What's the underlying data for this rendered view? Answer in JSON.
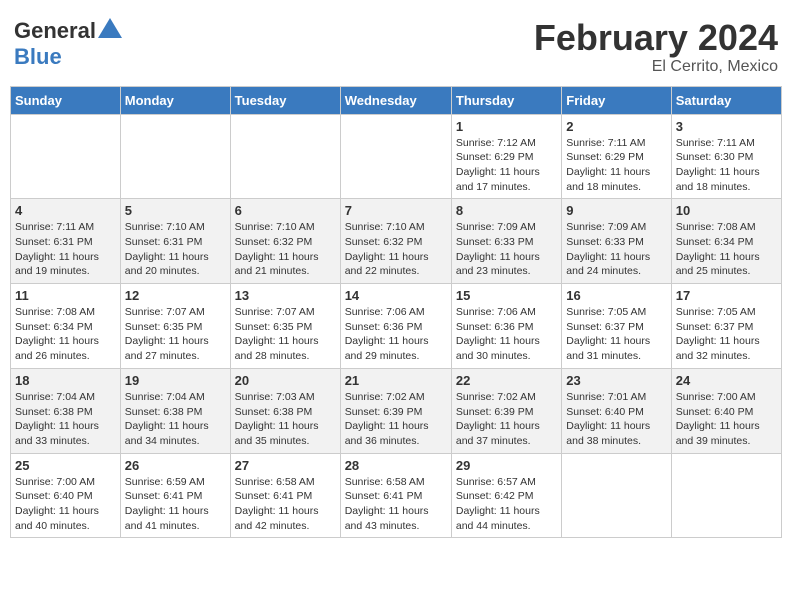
{
  "header": {
    "logo_general": "General",
    "logo_blue": "Blue",
    "month_year": "February 2024",
    "location": "El Cerrito, Mexico"
  },
  "weekdays": [
    "Sunday",
    "Monday",
    "Tuesday",
    "Wednesday",
    "Thursday",
    "Friday",
    "Saturday"
  ],
  "weeks": [
    [
      {
        "day": "",
        "sunrise": "",
        "sunset": "",
        "daylight": ""
      },
      {
        "day": "",
        "sunrise": "",
        "sunset": "",
        "daylight": ""
      },
      {
        "day": "",
        "sunrise": "",
        "sunset": "",
        "daylight": ""
      },
      {
        "day": "",
        "sunrise": "",
        "sunset": "",
        "daylight": ""
      },
      {
        "day": "1",
        "sunrise": "Sunrise: 7:12 AM",
        "sunset": "Sunset: 6:29 PM",
        "daylight": "Daylight: 11 hours and 17 minutes."
      },
      {
        "day": "2",
        "sunrise": "Sunrise: 7:11 AM",
        "sunset": "Sunset: 6:29 PM",
        "daylight": "Daylight: 11 hours and 18 minutes."
      },
      {
        "day": "3",
        "sunrise": "Sunrise: 7:11 AM",
        "sunset": "Sunset: 6:30 PM",
        "daylight": "Daylight: 11 hours and 18 minutes."
      }
    ],
    [
      {
        "day": "4",
        "sunrise": "Sunrise: 7:11 AM",
        "sunset": "Sunset: 6:31 PM",
        "daylight": "Daylight: 11 hours and 19 minutes."
      },
      {
        "day": "5",
        "sunrise": "Sunrise: 7:10 AM",
        "sunset": "Sunset: 6:31 PM",
        "daylight": "Daylight: 11 hours and 20 minutes."
      },
      {
        "day": "6",
        "sunrise": "Sunrise: 7:10 AM",
        "sunset": "Sunset: 6:32 PM",
        "daylight": "Daylight: 11 hours and 21 minutes."
      },
      {
        "day": "7",
        "sunrise": "Sunrise: 7:10 AM",
        "sunset": "Sunset: 6:32 PM",
        "daylight": "Daylight: 11 hours and 22 minutes."
      },
      {
        "day": "8",
        "sunrise": "Sunrise: 7:09 AM",
        "sunset": "Sunset: 6:33 PM",
        "daylight": "Daylight: 11 hours and 23 minutes."
      },
      {
        "day": "9",
        "sunrise": "Sunrise: 7:09 AM",
        "sunset": "Sunset: 6:33 PM",
        "daylight": "Daylight: 11 hours and 24 minutes."
      },
      {
        "day": "10",
        "sunrise": "Sunrise: 7:08 AM",
        "sunset": "Sunset: 6:34 PM",
        "daylight": "Daylight: 11 hours and 25 minutes."
      }
    ],
    [
      {
        "day": "11",
        "sunrise": "Sunrise: 7:08 AM",
        "sunset": "Sunset: 6:34 PM",
        "daylight": "Daylight: 11 hours and 26 minutes."
      },
      {
        "day": "12",
        "sunrise": "Sunrise: 7:07 AM",
        "sunset": "Sunset: 6:35 PM",
        "daylight": "Daylight: 11 hours and 27 minutes."
      },
      {
        "day": "13",
        "sunrise": "Sunrise: 7:07 AM",
        "sunset": "Sunset: 6:35 PM",
        "daylight": "Daylight: 11 hours and 28 minutes."
      },
      {
        "day": "14",
        "sunrise": "Sunrise: 7:06 AM",
        "sunset": "Sunset: 6:36 PM",
        "daylight": "Daylight: 11 hours and 29 minutes."
      },
      {
        "day": "15",
        "sunrise": "Sunrise: 7:06 AM",
        "sunset": "Sunset: 6:36 PM",
        "daylight": "Daylight: 11 hours and 30 minutes."
      },
      {
        "day": "16",
        "sunrise": "Sunrise: 7:05 AM",
        "sunset": "Sunset: 6:37 PM",
        "daylight": "Daylight: 11 hours and 31 minutes."
      },
      {
        "day": "17",
        "sunrise": "Sunrise: 7:05 AM",
        "sunset": "Sunset: 6:37 PM",
        "daylight": "Daylight: 11 hours and 32 minutes."
      }
    ],
    [
      {
        "day": "18",
        "sunrise": "Sunrise: 7:04 AM",
        "sunset": "Sunset: 6:38 PM",
        "daylight": "Daylight: 11 hours and 33 minutes."
      },
      {
        "day": "19",
        "sunrise": "Sunrise: 7:04 AM",
        "sunset": "Sunset: 6:38 PM",
        "daylight": "Daylight: 11 hours and 34 minutes."
      },
      {
        "day": "20",
        "sunrise": "Sunrise: 7:03 AM",
        "sunset": "Sunset: 6:38 PM",
        "daylight": "Daylight: 11 hours and 35 minutes."
      },
      {
        "day": "21",
        "sunrise": "Sunrise: 7:02 AM",
        "sunset": "Sunset: 6:39 PM",
        "daylight": "Daylight: 11 hours and 36 minutes."
      },
      {
        "day": "22",
        "sunrise": "Sunrise: 7:02 AM",
        "sunset": "Sunset: 6:39 PM",
        "daylight": "Daylight: 11 hours and 37 minutes."
      },
      {
        "day": "23",
        "sunrise": "Sunrise: 7:01 AM",
        "sunset": "Sunset: 6:40 PM",
        "daylight": "Daylight: 11 hours and 38 minutes."
      },
      {
        "day": "24",
        "sunrise": "Sunrise: 7:00 AM",
        "sunset": "Sunset: 6:40 PM",
        "daylight": "Daylight: 11 hours and 39 minutes."
      }
    ],
    [
      {
        "day": "25",
        "sunrise": "Sunrise: 7:00 AM",
        "sunset": "Sunset: 6:40 PM",
        "daylight": "Daylight: 11 hours and 40 minutes."
      },
      {
        "day": "26",
        "sunrise": "Sunrise: 6:59 AM",
        "sunset": "Sunset: 6:41 PM",
        "daylight": "Daylight: 11 hours and 41 minutes."
      },
      {
        "day": "27",
        "sunrise": "Sunrise: 6:58 AM",
        "sunset": "Sunset: 6:41 PM",
        "daylight": "Daylight: 11 hours and 42 minutes."
      },
      {
        "day": "28",
        "sunrise": "Sunrise: 6:58 AM",
        "sunset": "Sunset: 6:41 PM",
        "daylight": "Daylight: 11 hours and 43 minutes."
      },
      {
        "day": "29",
        "sunrise": "Sunrise: 6:57 AM",
        "sunset": "Sunset: 6:42 PM",
        "daylight": "Daylight: 11 hours and 44 minutes."
      },
      {
        "day": "",
        "sunrise": "",
        "sunset": "",
        "daylight": ""
      },
      {
        "day": "",
        "sunrise": "",
        "sunset": "",
        "daylight": ""
      }
    ]
  ]
}
